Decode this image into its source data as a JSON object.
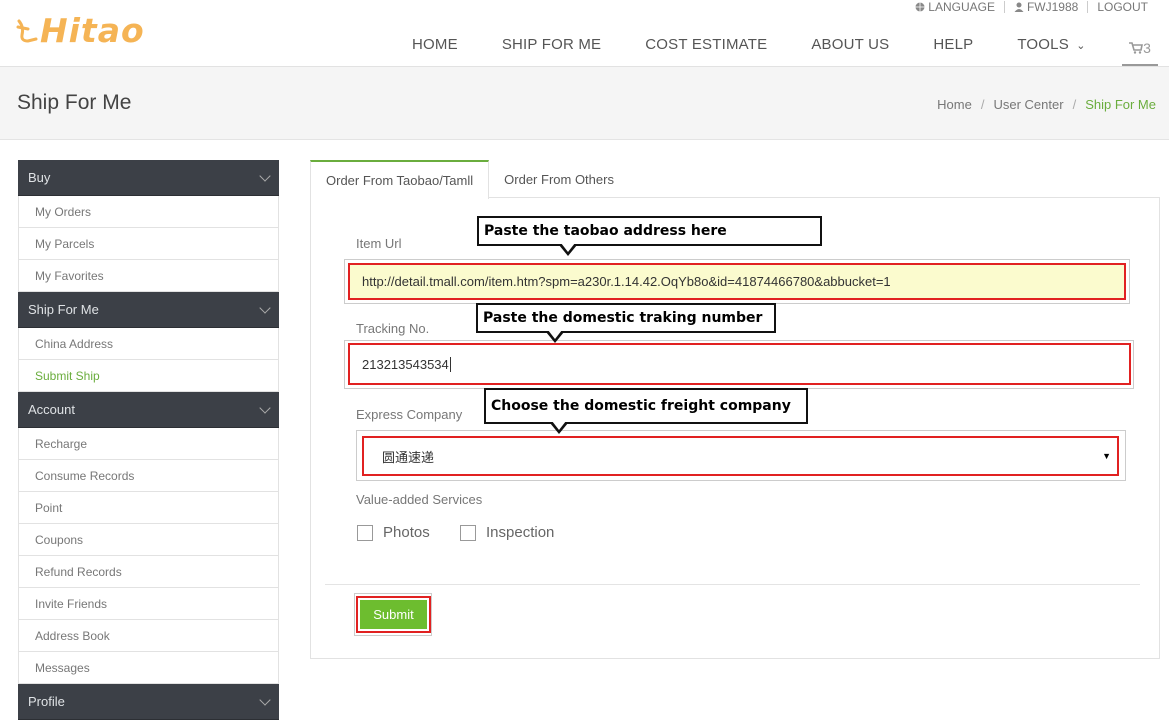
{
  "brand": {
    "logo_text": "Hitao",
    "accent": "#6aad3d",
    "highlight": "#e12121"
  },
  "topbar": {
    "language": "LANGUAGE",
    "user": "FWJ1988",
    "logout": "LOGOUT"
  },
  "nav": {
    "items": [
      "HOME",
      "SHIP FOR ME",
      "COST ESTIMATE",
      "ABOUT US",
      "HELP"
    ],
    "tools": "TOOLS",
    "cart_count": "3"
  },
  "title": "Ship For Me",
  "breadcrumb": [
    "Home",
    "User Center",
    "Ship For Me"
  ],
  "sidebar": {
    "sections": [
      {
        "title": "Buy",
        "items": [
          "My Orders",
          "My Parcels",
          "My Favorites"
        ]
      },
      {
        "title": "Ship For Me",
        "items": [
          "China Address",
          "Submit Ship"
        ]
      },
      {
        "title": "Account",
        "items": [
          "Recharge",
          "Consume Records",
          "Point",
          "Coupons",
          "Refund Records",
          "Invite Friends",
          "Address Book",
          "Messages"
        ]
      },
      {
        "title": "Profile",
        "items": []
      }
    ]
  },
  "tabs": [
    "Order From Taobao/Tamll",
    "Order From Others"
  ],
  "form": {
    "item_url_label": "Item Url",
    "item_url_value": "http://detail.tmall.com/item.htm?spm=a230r.1.14.42.OqYb8o&id=41874466780&abbucket=1",
    "tracking_label": "Tracking No.",
    "tracking_value": "213213543534",
    "express_label": "Express Company",
    "express_value": "圆通速递",
    "services_label": "Value-added Services",
    "services": [
      "Photos",
      "Inspection"
    ],
    "submit": "Submit"
  },
  "callouts": {
    "url": "Paste the taobao address here",
    "tracking": "Paste the domestic traking number",
    "express": "Choose the domestic freight company"
  }
}
